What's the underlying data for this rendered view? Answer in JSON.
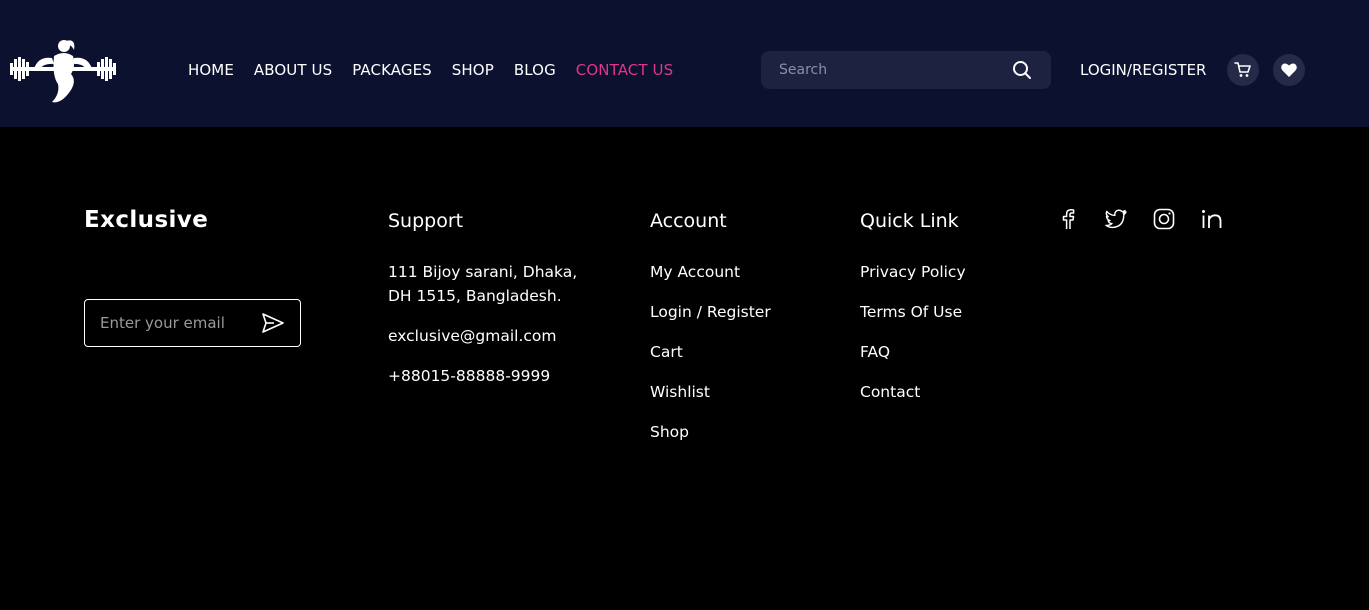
{
  "header": {
    "nav": [
      {
        "label": "HOME"
      },
      {
        "label": "ABOUT US"
      },
      {
        "label": "PACKAGES"
      },
      {
        "label": "SHOP"
      },
      {
        "label": "BLOG"
      },
      {
        "label": "CONTACT US",
        "active": true
      }
    ],
    "search_placeholder": "Search",
    "login_label": "LOGIN/REGISTER"
  },
  "footer": {
    "brand": "Exclusive",
    "subscribe_placeholder": "Enter your email",
    "support": {
      "title": "Support",
      "address_line1": "111 Bijoy sarani, Dhaka,",
      "address_line2": "DH 1515, Bangladesh.",
      "email": "exclusive@gmail.com",
      "phone": "+88015-88888-9999"
    },
    "account": {
      "title": "Account",
      "items": [
        "My Account",
        "Login / Register",
        "Cart",
        "Wishlist",
        "Shop"
      ]
    },
    "quick_link": {
      "title": "Quick Link",
      "items": [
        "Privacy Policy",
        "Terms Of Use",
        "FAQ",
        "Contact"
      ]
    },
    "social_icons": [
      "facebook-icon",
      "twitter-icon",
      "instagram-icon",
      "linkedin-icon"
    ]
  },
  "colors": {
    "header_bg": "#0c1130",
    "accent": "#e0368a",
    "search_bg": "#1c2240",
    "footer_bg": "#000000"
  }
}
